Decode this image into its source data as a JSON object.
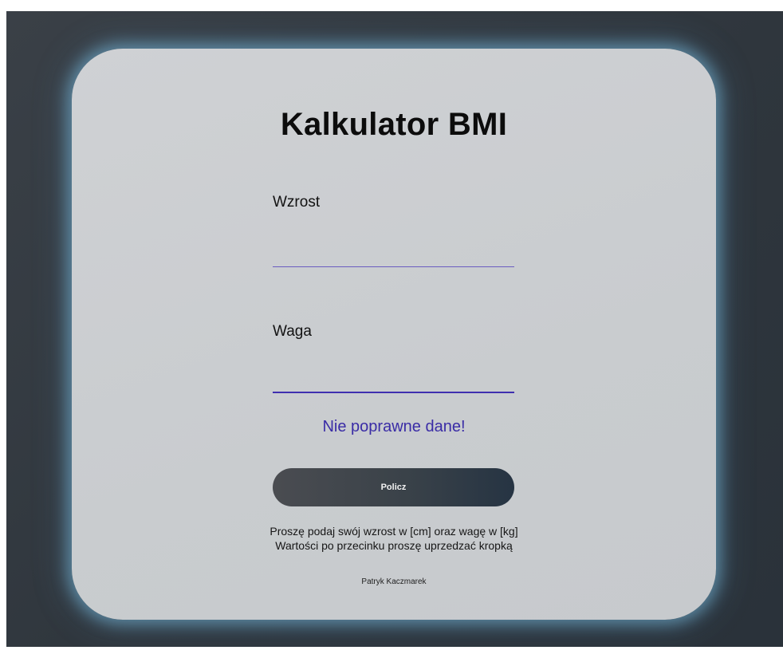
{
  "app": {
    "title": "Kalkulator BMI"
  },
  "form": {
    "height_label": "Wzrost",
    "height_value": "",
    "weight_label": "Waga",
    "weight_value": "",
    "error_message": "Nie poprawne dane!",
    "submit_label": "Policz"
  },
  "info": {
    "line1": "Proszę podaj swój wzrost w [cm] oraz wagę w [kg]",
    "line2": "Wartości po przecinku proszę uprzedzać kropką",
    "author": "Patryk Kaczmarek"
  },
  "colors": {
    "accent": "#3a2ca6",
    "button_dark": "#263443",
    "glow": "#78b9dc"
  }
}
